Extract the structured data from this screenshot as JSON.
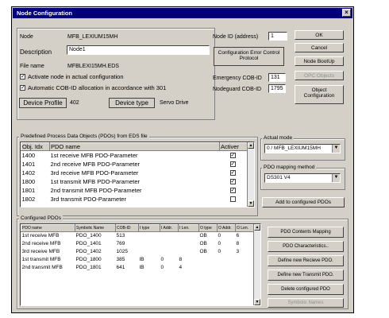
{
  "window": {
    "title": "Node Configuration",
    "close": "×"
  },
  "node": {
    "label": "Node",
    "value": "MFB_LEXIUM15MH",
    "description_label": "Description",
    "description_value": "Node1",
    "file_label": "File name",
    "file_value": "MFBLEXI15MH.EDS",
    "activate_label": "Activate node in actual configuration",
    "activate_checked": true,
    "auto_cob_label": "Automatic COB-ID allocation in accordance with 301",
    "auto_cob_checked": true,
    "profile_label": "Device Profile",
    "profile_value": "402",
    "type_label": "Device type",
    "type_value": "Servo Drive"
  },
  "right": {
    "node_id_label": "Node ID (address)",
    "node_id_value": "1",
    "config_error_label": "Configuration Error Control Protocol",
    "emergency_label": "Emergency COB-ID",
    "emergency_value": "131",
    "nodeguard_label": "Nodeguard COB-ID",
    "nodeguard_value": "1795"
  },
  "buttons": {
    "ok": "OK",
    "cancel": "Cancel",
    "node_bootup": "Node BootUp",
    "opc_objects": "OPC Objects",
    "object_configuration": "Object Configuration",
    "add_configured": "Add to configured PDOs",
    "pdo_mapping": "PDO Contents Mapping",
    "pdo_characteristics": "PDO Characteristics..",
    "new_receive": "Define new Recieve PDO.",
    "new_transmit": "Define new Transmit PDO.",
    "delete_pdo": "Delete configured PDO",
    "symbolic_names": "Symbolic Names"
  },
  "predefined": {
    "title": "Predefined Process Data Objects (PDOs) from EDS file",
    "columns": [
      "Obj. Idx",
      "PDO name",
      "Activer"
    ],
    "rows": [
      {
        "idx": "1400",
        "name": "1st receive MFB PDO-Parameter",
        "checked": true
      },
      {
        "idx": "1401",
        "name": "2nd receive MFB PDO-Parameter",
        "checked": true
      },
      {
        "idx": "1402",
        "name": "3rd receive MFB PDO-Parameter",
        "checked": true
      },
      {
        "idx": "1800",
        "name": "1st transmit MFB PDO-Parameter",
        "checked": true
      },
      {
        "idx": "1801",
        "name": "2nd transmit MFB PDO-Parameter",
        "checked": true
      },
      {
        "idx": "1802",
        "name": "3rd transmit PDO-Parameter",
        "checked": false
      }
    ]
  },
  "actual_mode": {
    "label": "Actual mode",
    "value": "0 / MFB_LEXIUM15MH"
  },
  "mapping_method": {
    "label": "PDO mapping method",
    "value": "DS301 V4"
  },
  "configured": {
    "title": "Configured PDOs",
    "columns": [
      "PDO name",
      "Symbolic Name",
      "COB-ID",
      "I type",
      "I Addr.",
      "I Len.",
      "O type",
      "O Addr.",
      "O Len."
    ],
    "rows": [
      [
        "1st receive MFB",
        "PDO_1400",
        "513",
        "",
        "",
        "",
        "OB",
        "0",
        "6"
      ],
      [
        "2nd receive MFB",
        "PDO_1401",
        "769",
        "",
        "",
        "",
        "OB",
        "0",
        "8"
      ],
      [
        "3rd receive MFB",
        "PDO_1402",
        "1025",
        "",
        "",
        "",
        "OB",
        "0",
        "3"
      ],
      [
        "1st transmit MFB",
        "PDO_1800",
        "385",
        "IB",
        "0",
        "8",
        "",
        "",
        ""
      ],
      [
        "2nd transmit MFB",
        "PDO_1801",
        "641",
        "IB",
        "0",
        "4",
        "",
        "",
        ""
      ]
    ]
  }
}
